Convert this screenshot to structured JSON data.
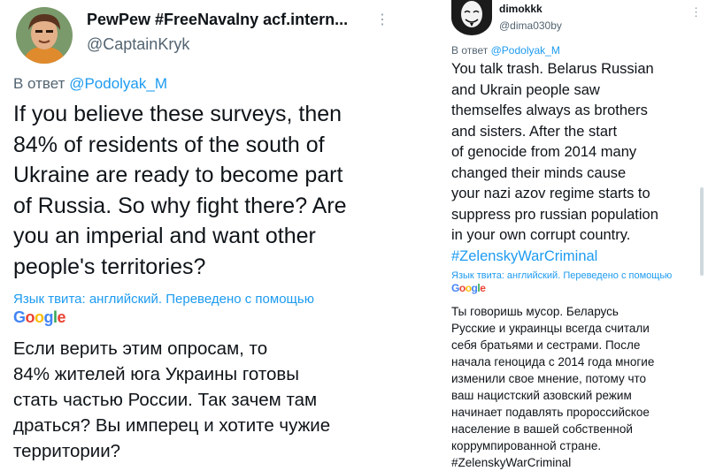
{
  "left_tweet": {
    "author_name": "PewPew #FreeNavalny acf.intern...",
    "author_handle": "@CaptainKryk",
    "reply_prefix": "В ответ",
    "reply_mention": "@Podolyak_M",
    "more_icon": "more-dots-icon",
    "text_lines": [
      "If you believe these surveys, then",
      "84% of residents of the south of",
      "Ukraine are ready to become part",
      "of Russia. So why fight there? Are",
      "you an imperial and want other",
      "people's territories?"
    ],
    "translation_note": "Язык твита: английский. Переведено с помощью",
    "translation_brand": "Google",
    "translation_lines": [
      "Если верить этим опросам, то",
      "84% жителей юга Украины готовы",
      "стать частью России. Так зачем там",
      "драться? Вы имперец и хотите чужие",
      "территории?"
    ]
  },
  "right_tweet": {
    "author_name": "dimokkk",
    "author_handle": "@dima030by",
    "reply_prefix": "В ответ",
    "reply_mention": "@Podolyak_M",
    "more_icon": "more-dots-icon",
    "text_lines": [
      "You talk trash. Belarus Russian",
      "and Ukrain people saw",
      "themselfes always as brothers",
      "and sisters. After the start",
      "of genocide from 2014 many",
      "changed their minds cause",
      "your nazi azov regime starts to",
      "suppress pro russian population",
      "in your own corrupt country."
    ],
    "hashtag": "#ZelenskyWarCriminal",
    "translation_note": "Язык твита: английский. Переведено с помощью",
    "translation_brand": "Google",
    "translation_lines": [
      "Ты говоришь мусор. Беларусь",
      "Русские и украинцы всегда считали",
      "себя братьями и сестрами. После",
      "начала геноцида с 2014 года многие",
      "изменили свое мнение, потому что",
      "ваш нацистский азовский режим",
      "начинает подавлять пророссийское",
      "население в вашей собственной",
      "коррумпированной стране.",
      "#ZelenskyWarCriminal"
    ]
  },
  "colors": {
    "link": "#1d9bf0",
    "secondary_text": "#536471",
    "primary_text": "#0f1419"
  }
}
